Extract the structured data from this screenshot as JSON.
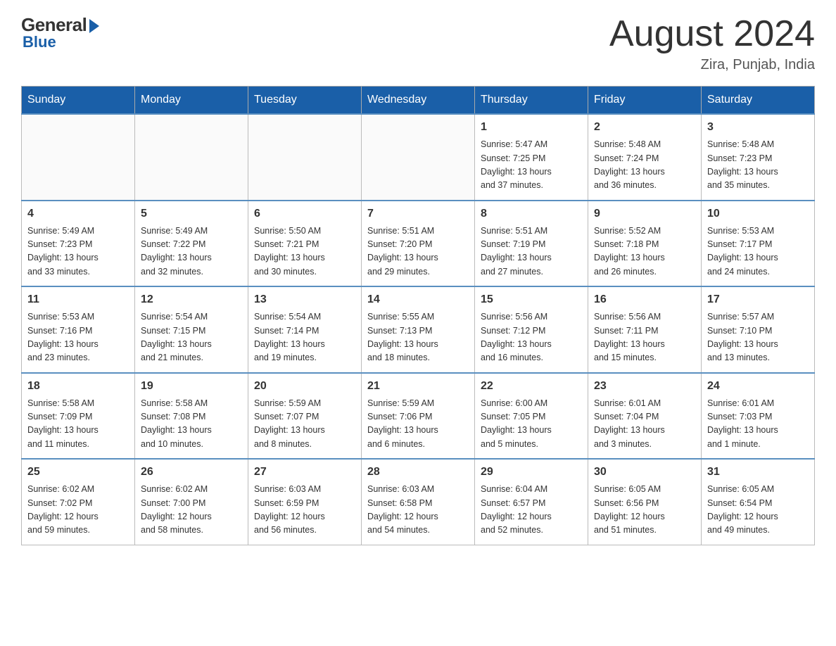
{
  "header": {
    "logo_general": "General",
    "logo_blue": "Blue",
    "month_title": "August 2024",
    "location": "Zira, Punjab, India"
  },
  "days_of_week": [
    "Sunday",
    "Monday",
    "Tuesday",
    "Wednesday",
    "Thursday",
    "Friday",
    "Saturday"
  ],
  "weeks": [
    [
      {
        "day": "",
        "info": ""
      },
      {
        "day": "",
        "info": ""
      },
      {
        "day": "",
        "info": ""
      },
      {
        "day": "",
        "info": ""
      },
      {
        "day": "1",
        "info": "Sunrise: 5:47 AM\nSunset: 7:25 PM\nDaylight: 13 hours\nand 37 minutes."
      },
      {
        "day": "2",
        "info": "Sunrise: 5:48 AM\nSunset: 7:24 PM\nDaylight: 13 hours\nand 36 minutes."
      },
      {
        "day": "3",
        "info": "Sunrise: 5:48 AM\nSunset: 7:23 PM\nDaylight: 13 hours\nand 35 minutes."
      }
    ],
    [
      {
        "day": "4",
        "info": "Sunrise: 5:49 AM\nSunset: 7:23 PM\nDaylight: 13 hours\nand 33 minutes."
      },
      {
        "day": "5",
        "info": "Sunrise: 5:49 AM\nSunset: 7:22 PM\nDaylight: 13 hours\nand 32 minutes."
      },
      {
        "day": "6",
        "info": "Sunrise: 5:50 AM\nSunset: 7:21 PM\nDaylight: 13 hours\nand 30 minutes."
      },
      {
        "day": "7",
        "info": "Sunrise: 5:51 AM\nSunset: 7:20 PM\nDaylight: 13 hours\nand 29 minutes."
      },
      {
        "day": "8",
        "info": "Sunrise: 5:51 AM\nSunset: 7:19 PM\nDaylight: 13 hours\nand 27 minutes."
      },
      {
        "day": "9",
        "info": "Sunrise: 5:52 AM\nSunset: 7:18 PM\nDaylight: 13 hours\nand 26 minutes."
      },
      {
        "day": "10",
        "info": "Sunrise: 5:53 AM\nSunset: 7:17 PM\nDaylight: 13 hours\nand 24 minutes."
      }
    ],
    [
      {
        "day": "11",
        "info": "Sunrise: 5:53 AM\nSunset: 7:16 PM\nDaylight: 13 hours\nand 23 minutes."
      },
      {
        "day": "12",
        "info": "Sunrise: 5:54 AM\nSunset: 7:15 PM\nDaylight: 13 hours\nand 21 minutes."
      },
      {
        "day": "13",
        "info": "Sunrise: 5:54 AM\nSunset: 7:14 PM\nDaylight: 13 hours\nand 19 minutes."
      },
      {
        "day": "14",
        "info": "Sunrise: 5:55 AM\nSunset: 7:13 PM\nDaylight: 13 hours\nand 18 minutes."
      },
      {
        "day": "15",
        "info": "Sunrise: 5:56 AM\nSunset: 7:12 PM\nDaylight: 13 hours\nand 16 minutes."
      },
      {
        "day": "16",
        "info": "Sunrise: 5:56 AM\nSunset: 7:11 PM\nDaylight: 13 hours\nand 15 minutes."
      },
      {
        "day": "17",
        "info": "Sunrise: 5:57 AM\nSunset: 7:10 PM\nDaylight: 13 hours\nand 13 minutes."
      }
    ],
    [
      {
        "day": "18",
        "info": "Sunrise: 5:58 AM\nSunset: 7:09 PM\nDaylight: 13 hours\nand 11 minutes."
      },
      {
        "day": "19",
        "info": "Sunrise: 5:58 AM\nSunset: 7:08 PM\nDaylight: 13 hours\nand 10 minutes."
      },
      {
        "day": "20",
        "info": "Sunrise: 5:59 AM\nSunset: 7:07 PM\nDaylight: 13 hours\nand 8 minutes."
      },
      {
        "day": "21",
        "info": "Sunrise: 5:59 AM\nSunset: 7:06 PM\nDaylight: 13 hours\nand 6 minutes."
      },
      {
        "day": "22",
        "info": "Sunrise: 6:00 AM\nSunset: 7:05 PM\nDaylight: 13 hours\nand 5 minutes."
      },
      {
        "day": "23",
        "info": "Sunrise: 6:01 AM\nSunset: 7:04 PM\nDaylight: 13 hours\nand 3 minutes."
      },
      {
        "day": "24",
        "info": "Sunrise: 6:01 AM\nSunset: 7:03 PM\nDaylight: 13 hours\nand 1 minute."
      }
    ],
    [
      {
        "day": "25",
        "info": "Sunrise: 6:02 AM\nSunset: 7:02 PM\nDaylight: 12 hours\nand 59 minutes."
      },
      {
        "day": "26",
        "info": "Sunrise: 6:02 AM\nSunset: 7:00 PM\nDaylight: 12 hours\nand 58 minutes."
      },
      {
        "day": "27",
        "info": "Sunrise: 6:03 AM\nSunset: 6:59 PM\nDaylight: 12 hours\nand 56 minutes."
      },
      {
        "day": "28",
        "info": "Sunrise: 6:03 AM\nSunset: 6:58 PM\nDaylight: 12 hours\nand 54 minutes."
      },
      {
        "day": "29",
        "info": "Sunrise: 6:04 AM\nSunset: 6:57 PM\nDaylight: 12 hours\nand 52 minutes."
      },
      {
        "day": "30",
        "info": "Sunrise: 6:05 AM\nSunset: 6:56 PM\nDaylight: 12 hours\nand 51 minutes."
      },
      {
        "day": "31",
        "info": "Sunrise: 6:05 AM\nSunset: 6:54 PM\nDaylight: 12 hours\nand 49 minutes."
      }
    ]
  ]
}
